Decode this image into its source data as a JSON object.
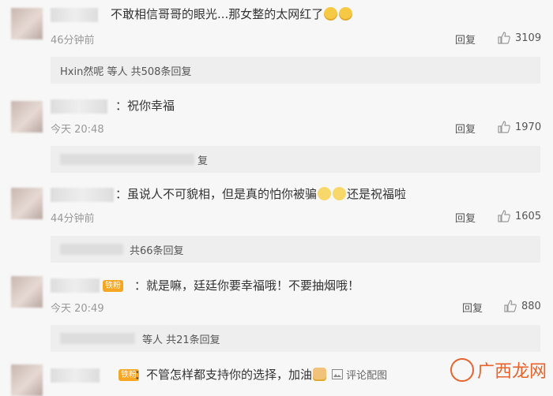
{
  "comments": [
    {
      "text": "不敢相信哥哥的眼光...那女整的太网红了",
      "emoji_names": [
        "emoji-cute",
        "emoji-cute"
      ],
      "time": "46分钟前",
      "reply_label": "回复",
      "likes": "3109",
      "sub_reply": "Hxin然呢 等人 共508条回复"
    },
    {
      "text": "祝你幸福",
      "time": "今天 20:48",
      "reply_label": "回复",
      "likes": "1970",
      "sub_reply_visible_tail": "复"
    },
    {
      "text_before": "虽说人不可貌相，但是真的怕你被骗",
      "text_after": "还是祝福啦",
      "time": "44分钟前",
      "reply_label": "回复",
      "likes": "1605",
      "sub_reply": "共66条回复"
    },
    {
      "badge": "铁粉",
      "text": "就是嘛，廷廷你要幸福哦！不要抽烟哦！",
      "time": "今天 20:49",
      "reply_label": "回复",
      "likes": "880",
      "sub_reply": "等人 共21条回复"
    },
    {
      "badge": "铁粉",
      "text": "不管怎样都支持你的选择，加油",
      "pic_label": "评论配图"
    }
  ],
  "watermark": "广西龙网",
  "colors": {
    "background": "#f7f7f7",
    "sub_background": "#eeeeee",
    "badge": "#f5a623",
    "watermark": "#e8632b"
  }
}
